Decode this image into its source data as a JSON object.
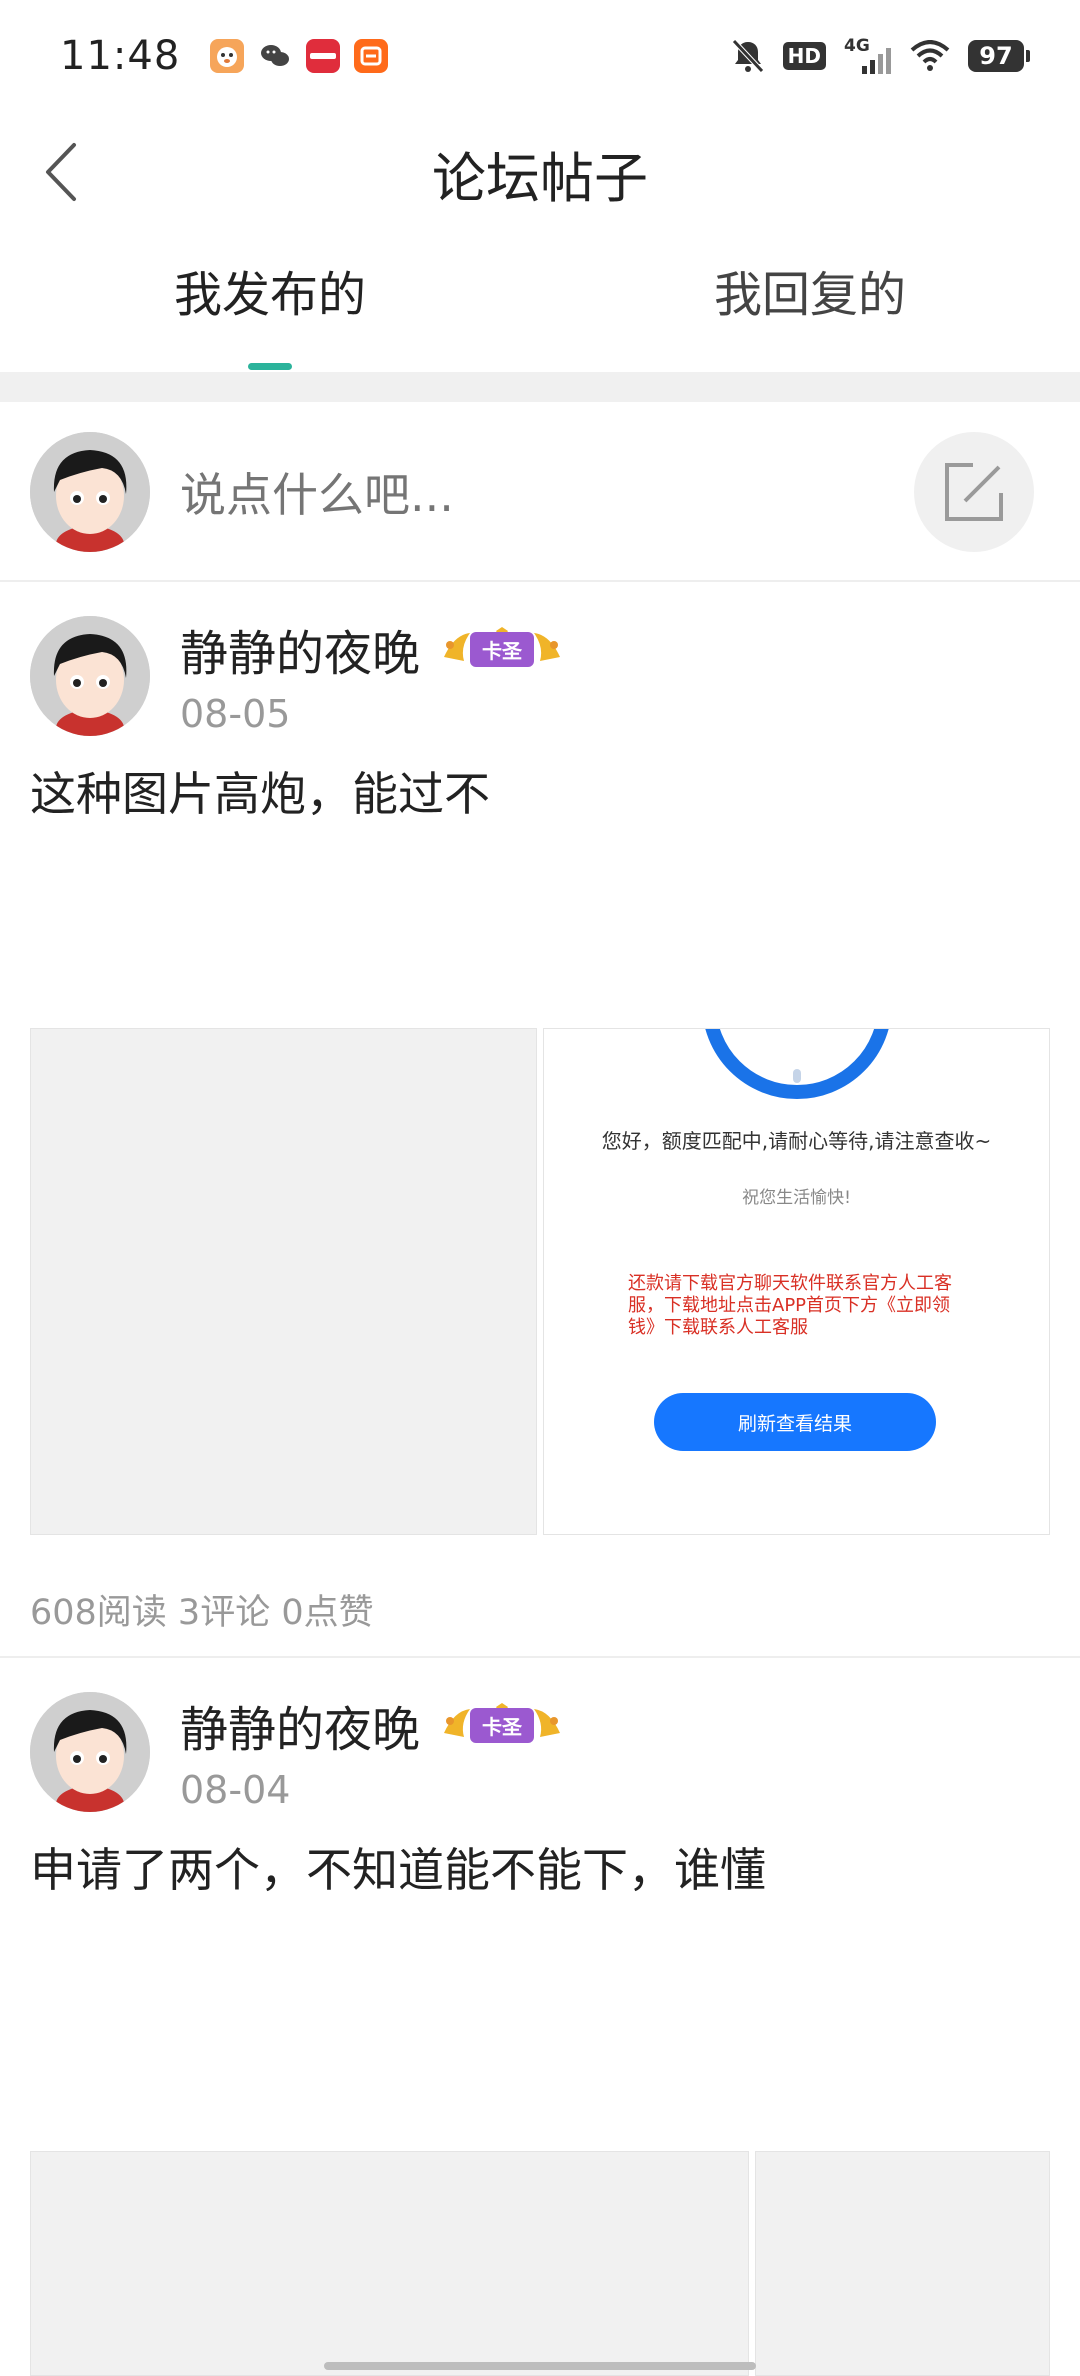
{
  "status_bar": {
    "time": "11:48",
    "app_icons": [
      "pet-app-icon",
      "wechat-icon",
      "xiaohongshu-icon",
      "taobao-icon"
    ],
    "hd_label": "HD",
    "network_label": "4G",
    "battery": "97"
  },
  "header": {
    "title": "论坛帖子"
  },
  "tabs": [
    {
      "label": "我发布的",
      "active": true
    },
    {
      "label": "我回复的",
      "active": false
    }
  ],
  "compose": {
    "placeholder": "说点什么吧..."
  },
  "posts": [
    {
      "author": "静静的夜晚",
      "badge": "卡圣",
      "date": "08-05",
      "text": "这种图片高炮，能过不",
      "screenshot": {
        "message": "您好，额度匹配中,请耐心等待,请注意查收~",
        "sub": "祝您生活愉快!",
        "notice": "还款请下载官方聊天软件联系官方人工客服，下载地址点击APP首页下方《立即领钱》下载联系人工客服",
        "button": "刷新查看结果"
      },
      "stats": "608阅读 3评论 0点赞"
    },
    {
      "author": "静静的夜晚",
      "badge": "卡圣",
      "date": "08-04",
      "text": "申请了两个，不知道能不能下，谁懂"
    }
  ],
  "colors": {
    "accent": "#2bb39b",
    "badge": "#9b59d0",
    "link_blue": "#1677ff",
    "notice_red": "#d93025"
  }
}
